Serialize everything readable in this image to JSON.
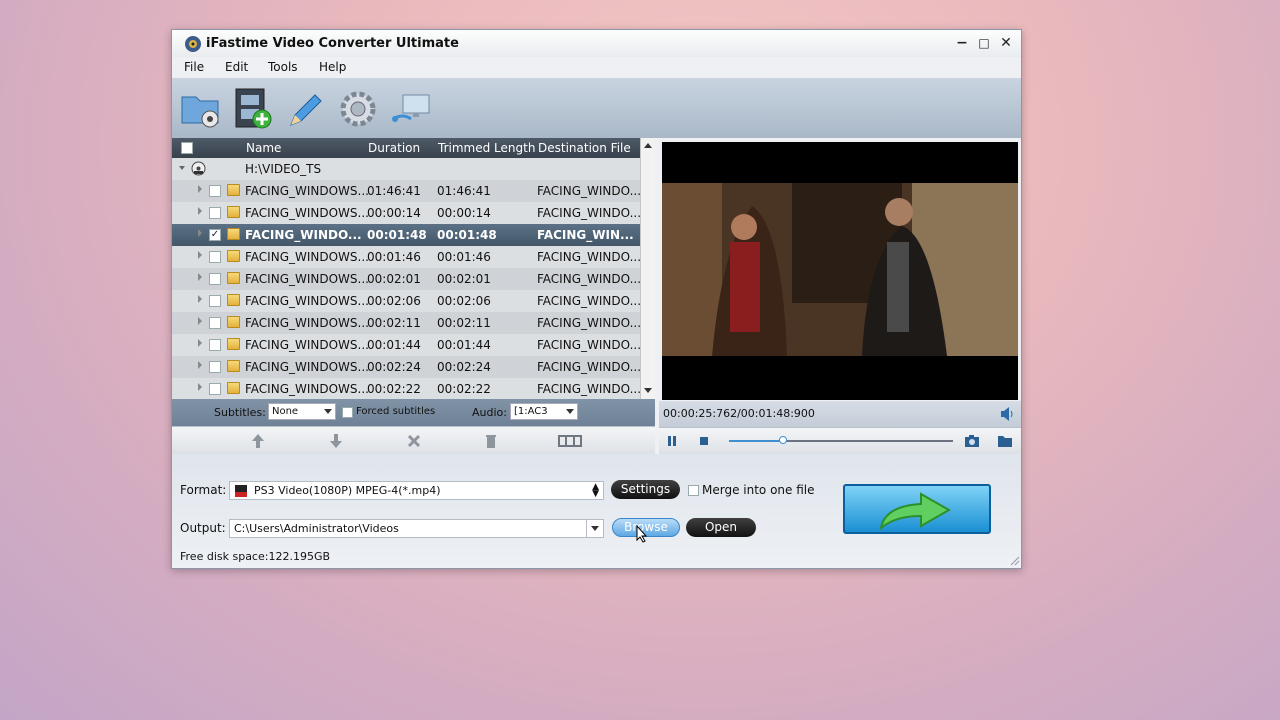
{
  "window": {
    "title": "iFastime Video Converter Ultimate",
    "controls": {
      "minimize": "−",
      "maximize": "□",
      "close": "✕"
    }
  },
  "menu": [
    "File",
    "Edit",
    "Tools",
    "Help"
  ],
  "toolbar": {
    "icons": [
      "add-folder-icon",
      "add-video-icon",
      "edit-icon",
      "settings-gear-icon",
      "network-icon"
    ]
  },
  "list": {
    "columns": {
      "name": "Name",
      "duration": "Duration",
      "trimmed": "Trimmed Length",
      "destination": "Destination File"
    },
    "root": "H:\\VIDEO_TS",
    "rows": [
      {
        "name": "FACING_WINDOWS...",
        "duration": "01:46:41",
        "trimmed": "01:46:41",
        "dest": "FACING_WINDO...",
        "checked": false,
        "selected": false
      },
      {
        "name": "FACING_WINDOWS...",
        "duration": "00:00:14",
        "trimmed": "00:00:14",
        "dest": "FACING_WINDO...",
        "checked": false,
        "selected": false
      },
      {
        "name": "FACING_WINDO...",
        "duration": "00:01:48",
        "trimmed": "00:01:48",
        "dest": "FACING_WIN...",
        "checked": true,
        "selected": true
      },
      {
        "name": "FACING_WINDOWS...",
        "duration": "00:01:46",
        "trimmed": "00:01:46",
        "dest": "FACING_WINDO...",
        "checked": false,
        "selected": false
      },
      {
        "name": "FACING_WINDOWS...",
        "duration": "00:02:01",
        "trimmed": "00:02:01",
        "dest": "FACING_WINDO...",
        "checked": false,
        "selected": false
      },
      {
        "name": "FACING_WINDOWS...",
        "duration": "00:02:06",
        "trimmed": "00:02:06",
        "dest": "FACING_WINDO...",
        "checked": false,
        "selected": false
      },
      {
        "name": "FACING_WINDOWS...",
        "duration": "00:02:11",
        "trimmed": "00:02:11",
        "dest": "FACING_WINDO...",
        "checked": false,
        "selected": false
      },
      {
        "name": "FACING_WINDOWS...",
        "duration": "00:01:44",
        "trimmed": "00:01:44",
        "dest": "FACING_WINDO...",
        "checked": false,
        "selected": false
      },
      {
        "name": "FACING_WINDOWS...",
        "duration": "00:02:24",
        "trimmed": "00:02:24",
        "dest": "FACING_WINDO...",
        "checked": false,
        "selected": false
      },
      {
        "name": "FACING_WINDOWS...",
        "duration": "00:02:22",
        "trimmed": "00:02:22",
        "dest": "FACING_WINDO...",
        "checked": false,
        "selected": false
      }
    ]
  },
  "subtitles": {
    "label": "Subtitles:",
    "value": "None",
    "forced_label": "Forced subtitles",
    "audio_label": "Audio:",
    "audio_value": "[1:AC3"
  },
  "preview": {
    "time": "00:00:25:762/00:01:48:900",
    "progress": 0.24
  },
  "format": {
    "label": "Format:",
    "value": "PS3 Video(1080P) MPEG-4(*.mp4)",
    "settings_label": "Settings",
    "merge_label": "Merge into one file"
  },
  "output": {
    "label": "Output:",
    "value": "C:\\Users\\Administrator\\Videos",
    "browse_label": "Browse",
    "open_label": "Open"
  },
  "disk": {
    "text": "Free disk space:122.195GB"
  }
}
